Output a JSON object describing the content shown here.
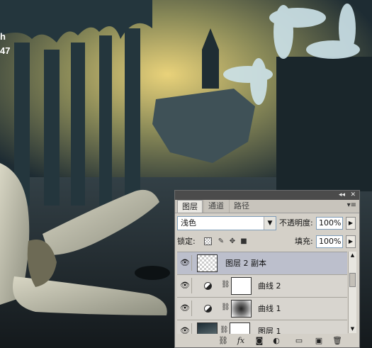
{
  "watermark": {
    "line1": "h",
    "line2": "47"
  },
  "panel": {
    "title_controls": {
      "collapse": "◂◂",
      "close": "✕"
    },
    "tabs": [
      {
        "label": "图层"
      },
      {
        "label": "通道"
      },
      {
        "label": "路径"
      }
    ],
    "menu_icon": "panel-menu-icon",
    "blend_mode": "浅色",
    "opacity_label": "不透明度:",
    "opacity_value": "100%",
    "lock_label": "锁定:",
    "fill_label": "填充:",
    "fill_value": "100%",
    "layers": [
      {
        "name": "图层 2 副本",
        "selected": true,
        "thumb": "checker"
      },
      {
        "name": "曲线 2",
        "selected": false,
        "thumb": "white"
      },
      {
        "name": "曲线 1",
        "selected": false,
        "thumb": "radial"
      },
      {
        "name": "图层 1",
        "selected": false,
        "thumb": "photo"
      }
    ],
    "bottom_icons": [
      "link-icon",
      "fx-icon",
      "mask-icon",
      "adjustment-icon",
      "folder-icon",
      "new-layer-icon",
      "trash-icon"
    ]
  },
  "colors": {
    "panel_bg": "#d4d0c8",
    "selected_row": "#bcbfcc",
    "titlebar": "#4b4b4b"
  }
}
